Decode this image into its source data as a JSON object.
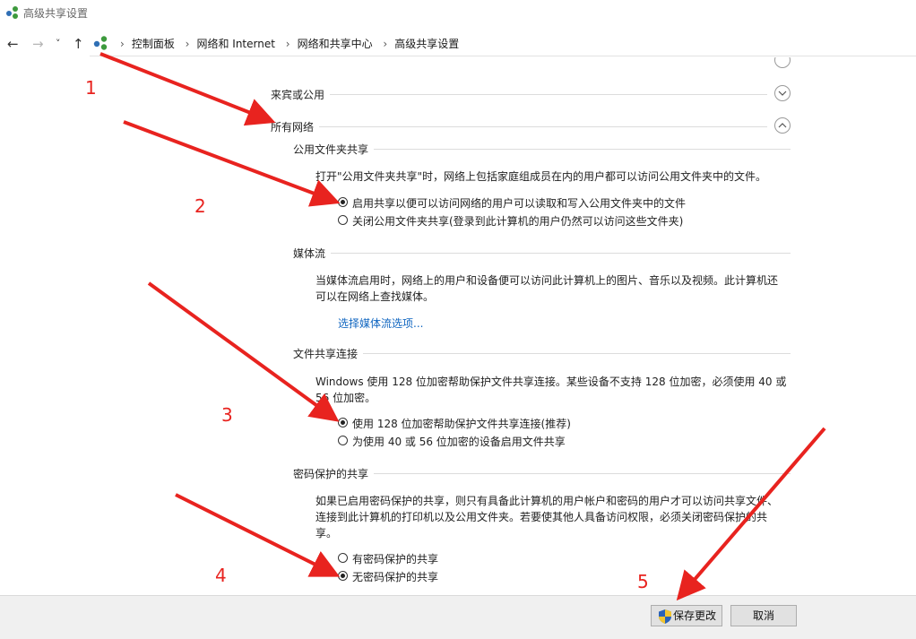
{
  "window": {
    "title": "高级共享设置"
  },
  "nav": {
    "back": "←",
    "forward": "→",
    "dropdown": "˅",
    "up": "↑"
  },
  "breadcrumb": [
    "控制面板",
    "网络和 Internet",
    "网络和共享中心",
    "高级共享设置"
  ],
  "sections": {
    "guest": "来宾或公用",
    "all": "所有网络"
  },
  "public_folder": {
    "heading": "公用文件夹共享",
    "desc": "打开\"公用文件夹共享\"时，网络上包括家庭组成员在内的用户都可以访问公用文件夹中的文件。",
    "opt_on": "启用共享以便可以访问网络的用户可以读取和写入公用文件夹中的文件",
    "opt_off": "关闭公用文件夹共享(登录到此计算机的用户仍然可以访问这些文件夹)"
  },
  "media": {
    "heading": "媒体流",
    "desc_l1": "当媒体流启用时，网络上的用户和设备便可以访问此计算机上的图片、音乐以及视频。此计算机还",
    "desc_l2": "可以在网络上查找媒体。",
    "link": "选择媒体流选项..."
  },
  "file_sharing": {
    "heading": "文件共享连接",
    "desc_l1": "Windows 使用 128 位加密帮助保护文件共享连接。某些设备不支持 128 位加密，必须使用 40 或",
    "desc_l2": "56 位加密。",
    "opt_128": "使用 128 位加密帮助保护文件共享连接(推荐)",
    "opt_40": "为使用 40 或 56 位加密的设备启用文件共享"
  },
  "password": {
    "heading": "密码保护的共享",
    "desc_l1": "如果已启用密码保护的共享，则只有具备此计算机的用户帐户和密码的用户才可以访问共享文件、",
    "desc_l2": "连接到此计算机的打印机以及公用文件夹。若要使其他人具备访问权限，必须关闭密码保护的共",
    "desc_l3": "享。",
    "opt_on": "有密码保护的共享",
    "opt_off": "无密码保护的共享"
  },
  "buttons": {
    "save": "保存更改",
    "cancel": "取消"
  },
  "annotations": [
    "1",
    "2",
    "3",
    "4",
    "5"
  ],
  "colors": {
    "annotation": "#e8231f",
    "link": "#1066c0"
  }
}
